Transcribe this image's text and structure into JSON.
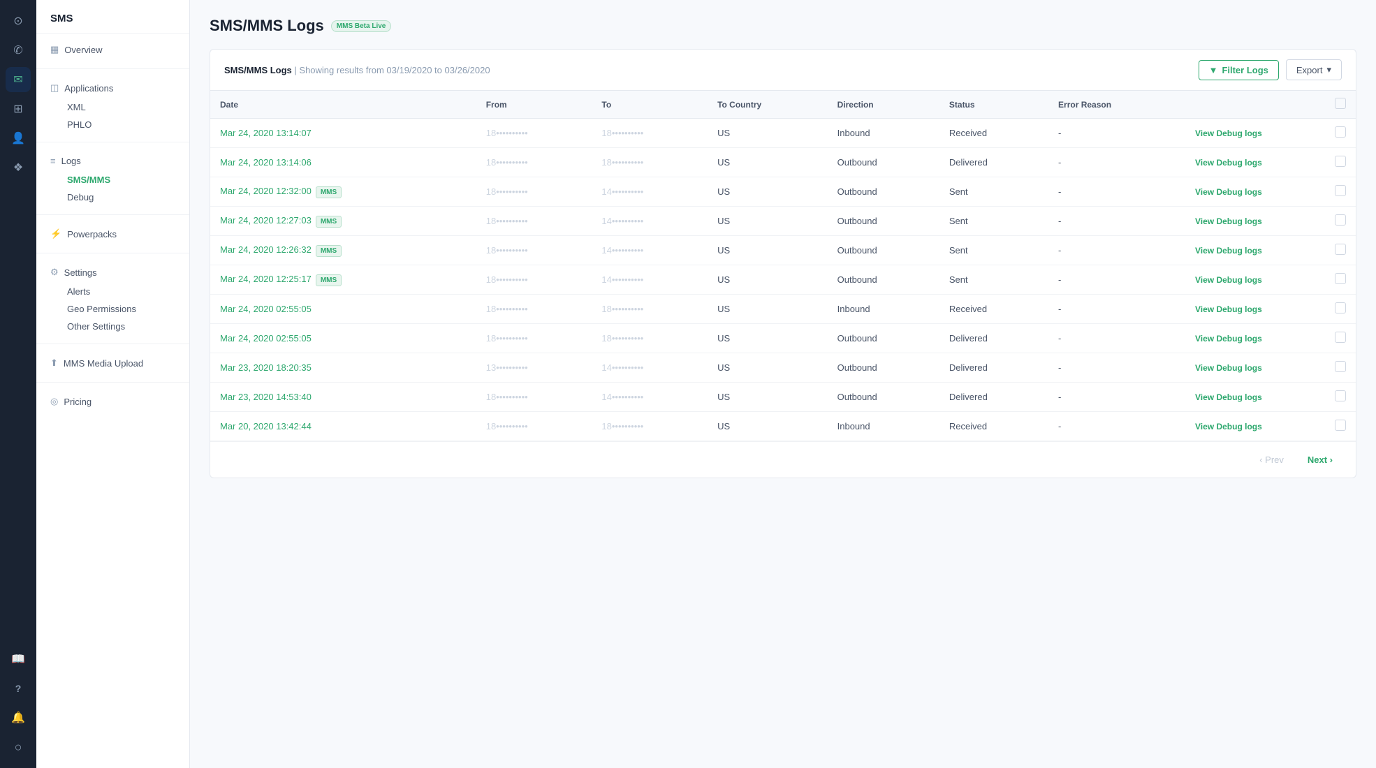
{
  "iconNav": {
    "items": [
      {
        "name": "home-icon",
        "icon": "⊙",
        "active": false
      },
      {
        "name": "phone-icon",
        "icon": "✆",
        "active": false
      },
      {
        "name": "sms-icon",
        "icon": "✉",
        "active": true
      },
      {
        "name": "grid-icon",
        "icon": "⊞",
        "active": false
      },
      {
        "name": "people-icon",
        "icon": "👤",
        "active": false
      },
      {
        "name": "layers-icon",
        "icon": "❖",
        "active": false
      },
      {
        "name": "book-icon",
        "icon": "📖",
        "active": false
      },
      {
        "name": "help-icon",
        "icon": "?",
        "active": false
      },
      {
        "name": "bell-icon",
        "icon": "🔔",
        "active": false
      },
      {
        "name": "globe-icon",
        "icon": "○",
        "active": false
      }
    ]
  },
  "sidebar": {
    "title": "SMS",
    "sections": [
      {
        "items": [
          {
            "label": "Overview",
            "icon": "▦",
            "active": false,
            "type": "item",
            "name": "overview"
          }
        ]
      },
      {
        "items": [
          {
            "label": "Applications",
            "icon": "◫",
            "active": false,
            "type": "item",
            "name": "applications"
          },
          {
            "label": "XML",
            "active": false,
            "type": "sub",
            "name": "xml"
          },
          {
            "label": "PHLO",
            "active": false,
            "type": "sub",
            "name": "phlo"
          }
        ]
      },
      {
        "items": [
          {
            "label": "Logs",
            "icon": "≡",
            "active": false,
            "type": "item",
            "name": "logs"
          },
          {
            "label": "SMS/MMS",
            "active": true,
            "type": "sub",
            "name": "sms-mms"
          },
          {
            "label": "Debug",
            "active": false,
            "type": "sub",
            "name": "debug"
          }
        ]
      },
      {
        "items": [
          {
            "label": "Powerpacks",
            "icon": "⚡",
            "active": false,
            "type": "item",
            "name": "powerpacks"
          }
        ]
      },
      {
        "items": [
          {
            "label": "Settings",
            "icon": "⚙",
            "active": false,
            "type": "item",
            "name": "settings"
          },
          {
            "label": "Alerts",
            "active": false,
            "type": "sub",
            "name": "alerts"
          },
          {
            "label": "Geo Permissions",
            "active": false,
            "type": "sub",
            "name": "geo-permissions"
          },
          {
            "label": "Other Settings",
            "active": false,
            "type": "sub",
            "name": "other-settings"
          }
        ]
      },
      {
        "items": [
          {
            "label": "MMS Media Upload",
            "icon": "⬆",
            "active": false,
            "type": "item",
            "name": "mms-media-upload"
          }
        ]
      },
      {
        "items": [
          {
            "label": "Pricing",
            "icon": "◎",
            "active": false,
            "type": "item",
            "name": "pricing"
          }
        ]
      }
    ]
  },
  "page": {
    "title": "SMS/MMS Logs",
    "badge": "MMS Beta Live"
  },
  "card": {
    "title": "SMS/MMS Logs",
    "subtitle": "| Showing results from 03/19/2020 to 03/26/2020",
    "filterBtn": "Filter Logs",
    "exportBtn": "Export"
  },
  "table": {
    "columns": [
      "Date",
      "From",
      "To",
      "To Country",
      "Direction",
      "Status",
      "Error Reason"
    ],
    "rows": [
      {
        "date": "Mar 24, 2020 13:14:07",
        "mms": false,
        "from": "18••••••••••",
        "to": "18••••••••••",
        "toCountry": "US",
        "direction": "Inbound",
        "status": "Received",
        "errorReason": "-"
      },
      {
        "date": "Mar 24, 2020 13:14:06",
        "mms": false,
        "from": "18••••••••••",
        "to": "18••••••••••",
        "toCountry": "US",
        "direction": "Outbound",
        "status": "Delivered",
        "errorReason": "-"
      },
      {
        "date": "Mar 24, 2020 12:32:00",
        "mms": true,
        "from": "18••••••••••",
        "to": "14••••••••••",
        "toCountry": "US",
        "direction": "Outbound",
        "status": "Sent",
        "errorReason": "-"
      },
      {
        "date": "Mar 24, 2020 12:27:03",
        "mms": true,
        "from": "18••••••••••",
        "to": "14••••••••••",
        "toCountry": "US",
        "direction": "Outbound",
        "status": "Sent",
        "errorReason": "-"
      },
      {
        "date": "Mar 24, 2020 12:26:32",
        "mms": true,
        "from": "18••••••••••",
        "to": "14••••••••••",
        "toCountry": "US",
        "direction": "Outbound",
        "status": "Sent",
        "errorReason": "-"
      },
      {
        "date": "Mar 24, 2020 12:25:17",
        "mms": true,
        "from": "18••••••••••",
        "to": "14••••••••••",
        "toCountry": "US",
        "direction": "Outbound",
        "status": "Sent",
        "errorReason": "-"
      },
      {
        "date": "Mar 24, 2020 02:55:05",
        "mms": false,
        "from": "18••••••••••",
        "to": "18••••••••••",
        "toCountry": "US",
        "direction": "Inbound",
        "status": "Received",
        "errorReason": "-"
      },
      {
        "date": "Mar 24, 2020 02:55:05",
        "mms": false,
        "from": "18••••••••••",
        "to": "18••••••••••",
        "toCountry": "US",
        "direction": "Outbound",
        "status": "Delivered",
        "errorReason": "-"
      },
      {
        "date": "Mar 23, 2020 18:20:35",
        "mms": false,
        "from": "13••••••••••",
        "to": "14••••••••••",
        "toCountry": "US",
        "direction": "Outbound",
        "status": "Delivered",
        "errorReason": "-"
      },
      {
        "date": "Mar 23, 2020 14:53:40",
        "mms": false,
        "from": "18••••••••••",
        "to": "14••••••••••",
        "toCountry": "US",
        "direction": "Outbound",
        "status": "Delivered",
        "errorReason": "-"
      },
      {
        "date": "Mar 20, 2020 13:42:44",
        "mms": false,
        "from": "18••••••••••",
        "to": "18••••••••••",
        "toCountry": "US",
        "direction": "Inbound",
        "status": "Received",
        "errorReason": "-"
      }
    ],
    "viewDebugLabel": "View Debug logs"
  },
  "pagination": {
    "prevLabel": "‹ Prev",
    "nextLabel": "Next ›"
  }
}
